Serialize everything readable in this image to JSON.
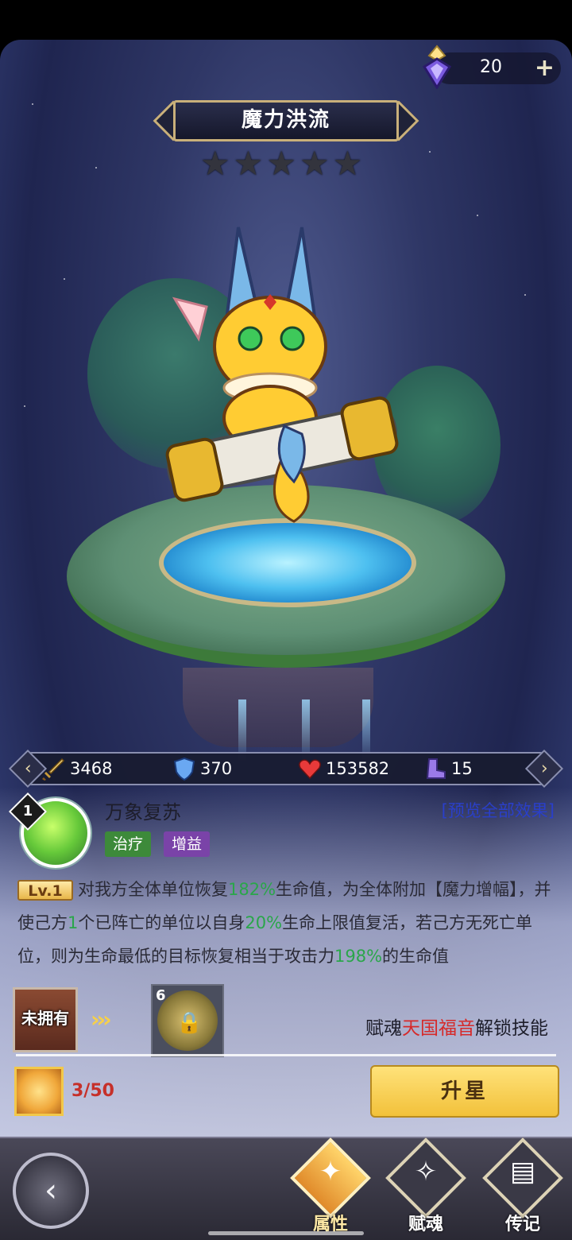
{
  "currency": {
    "count": "20",
    "plus": "+"
  },
  "hero": {
    "name": "魔力洪流",
    "stars": [
      "★",
      "★",
      "★",
      "★",
      "★"
    ]
  },
  "stats": {
    "attack": "3468",
    "defense": "370",
    "hp": "153582",
    "speed": "15",
    "prev_arrow": "‹",
    "next_arrow": "›"
  },
  "skill": {
    "level_badge": "1",
    "name": "万象复苏",
    "tags": [
      "治疗",
      "增益"
    ],
    "preview_link": "[预览全部效果]",
    "lv_label": "Lv.1",
    "desc_parts": [
      "对我方全体单位恢复",
      "182%",
      "生命值，为全体附加【魔力增幅】，并使己方",
      "1",
      "个已阵亡的单位以自身",
      "20%",
      "生命上限值复活，若己方无死亡单位，则为生命最低的目标恢复相当于攻击力",
      "198%",
      "的生命值"
    ]
  },
  "unlock": {
    "unowned_label": "未拥有",
    "chevrons": "›››",
    "locked_level": "6",
    "text_prefix": "赋魂",
    "text_highlight": "天国福音",
    "text_suffix": "解锁技能"
  },
  "progress": {
    "shards": "3/50",
    "upstar_button": "升星"
  },
  "nav": {
    "back": "‹",
    "tabs": [
      {
        "label": "属性",
        "active": true
      },
      {
        "label": "赋魂",
        "active": false
      },
      {
        "label": "传记",
        "active": false
      }
    ]
  },
  "colors": {
    "accent_gold": "#f2c13a",
    "highlight_green": "#2aa64a",
    "highlight_red": "#d62a2a",
    "link_blue": "#2a3fc9"
  }
}
